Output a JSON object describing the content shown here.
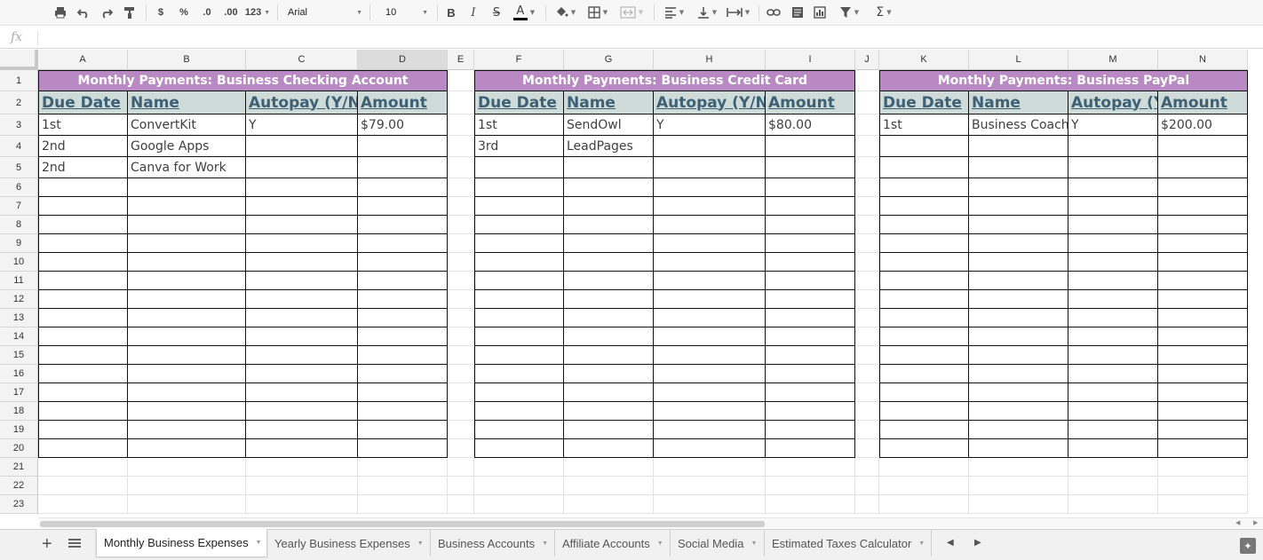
{
  "toolbar": {
    "currency": "$",
    "percent": "%",
    "decrease_decimal": ".0",
    "increase_decimal": ".00",
    "more_formats": "123",
    "font": "Arial",
    "font_size": "10",
    "bold": "B",
    "italic": "I",
    "strike": "S",
    "text_color_glyph": "A",
    "functions": "Σ",
    "icons": [
      "print-icon",
      "undo-icon",
      "redo-icon",
      "paint-format-icon",
      "fill-color-icon",
      "borders-icon",
      "merge-cells-icon",
      "align-icon",
      "valign-icon",
      "wrap-icon",
      "link-icon",
      "comment-icon",
      "chart-icon",
      "filter-icon",
      "functions-icon"
    ]
  },
  "formula_bar": {
    "fx": "fx",
    "value": ""
  },
  "columns": [
    "A",
    "B",
    "C",
    "D",
    "E",
    "F",
    "G",
    "H",
    "I",
    "J",
    "K",
    "L",
    "M",
    "N"
  ],
  "rows": [
    "1",
    "2",
    "3",
    "4",
    "5",
    "6",
    "7",
    "8",
    "9",
    "10",
    "11",
    "12",
    "13",
    "14",
    "15",
    "16",
    "17",
    "18",
    "19",
    "20",
    "21",
    "22",
    "23"
  ],
  "tables": [
    {
      "title": "Monthly Payments: Business Checking Account",
      "headers": [
        "Due Date",
        "Name",
        "Autopay (Y/N)",
        "Amount"
      ],
      "rows": [
        [
          "1st",
          "ConvertKit",
          "Y",
          "$79.00"
        ],
        [
          "2nd",
          "Google Apps",
          "",
          ""
        ],
        [
          "2nd",
          "Canva for Work",
          "",
          ""
        ]
      ]
    },
    {
      "title": "Monthly Payments: Business Credit Card",
      "headers": [
        "Due Date",
        "Name",
        "Autopay (Y/N)",
        "Amount"
      ],
      "rows": [
        [
          "1st",
          "SendOwl",
          "Y",
          "$80.00"
        ],
        [
          "3rd",
          "LeadPages",
          "",
          ""
        ]
      ]
    },
    {
      "title": "Monthly Payments: Business PayPal",
      "headers": [
        "Due Date",
        "Name",
        "Autopay (Y/N)",
        "Amount"
      ],
      "rows": [
        [
          "1st",
          "Business Coach",
          "Y",
          "$200.00"
        ]
      ]
    }
  ],
  "sheet_tabs": [
    {
      "label": "Monthly Business Expenses",
      "active": true
    },
    {
      "label": "Yearly Business Expenses",
      "active": false
    },
    {
      "label": "Business Accounts",
      "active": false
    },
    {
      "label": "Affiliate Accounts",
      "active": false
    },
    {
      "label": "Social Media",
      "active": false
    },
    {
      "label": "Estimated Taxes Calculator",
      "active": false
    }
  ],
  "colors": {
    "title_bg": "#b889c3",
    "header_bg": "#cfdbd9",
    "header_text": "#3d6075",
    "active_col": "#dcdcdc"
  }
}
